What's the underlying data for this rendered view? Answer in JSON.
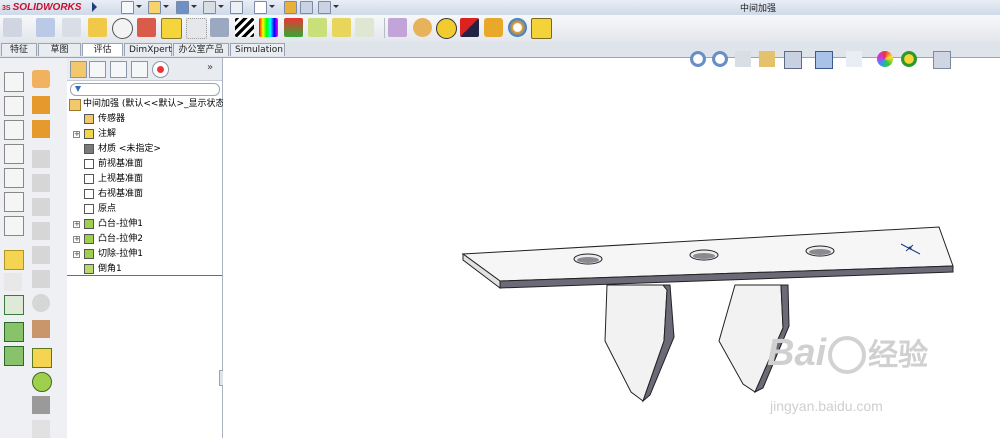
{
  "app": {
    "brand": "SOLIDWORKS",
    "brand_prefix": "3S",
    "document_title": "中间加强"
  },
  "tabs": [
    {
      "label": "特征",
      "active": false
    },
    {
      "label": "草图",
      "active": false
    },
    {
      "label": "评估",
      "active": true
    },
    {
      "label": "DimXpert",
      "active": false
    },
    {
      "label": "办公室产品",
      "active": false
    },
    {
      "label": "Simulation",
      "active": false
    }
  ],
  "feature_tree": {
    "root": "中间加强  (默认<<默认>_显示状态",
    "items": [
      {
        "label": "传感器",
        "icon": "sensor-icon",
        "expandable": false
      },
      {
        "label": "注解",
        "icon": "annotation-icon",
        "expandable": true
      },
      {
        "label": "材质 <未指定>",
        "icon": "material-icon",
        "expandable": false
      },
      {
        "label": "前视基准面",
        "icon": "plane-icon",
        "expandable": false
      },
      {
        "label": "上视基准面",
        "icon": "plane-icon",
        "expandable": false
      },
      {
        "label": "右视基准面",
        "icon": "plane-icon",
        "expandable": false
      },
      {
        "label": "原点",
        "icon": "origin-icon",
        "expandable": false
      },
      {
        "label": "凸台-拉伸1",
        "icon": "boss-extrude-icon",
        "expandable": true
      },
      {
        "label": "凸台-拉伸2",
        "icon": "boss-extrude-icon",
        "expandable": true
      },
      {
        "label": "切除-拉伸1",
        "icon": "cut-extrude-icon",
        "expandable": true
      },
      {
        "label": "倒角1",
        "icon": "chamfer-icon",
        "expandable": false
      }
    ]
  },
  "watermark": {
    "main": "Bai",
    "brand_cn": "经验",
    "url": "jingyan.baidu.com"
  },
  "colors": {
    "accent": "#c8102e",
    "part_face": "#f4f4f4",
    "part_edge": "#2a2a2a",
    "part_side": "#6b6b78"
  }
}
